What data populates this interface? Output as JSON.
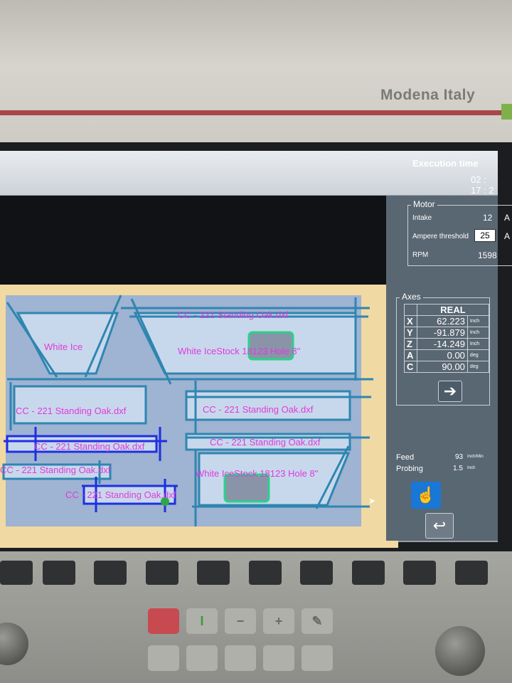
{
  "brand": "Modena Italy",
  "execution": {
    "label": "Execution time",
    "value": "02 : 17 : 2"
  },
  "motor": {
    "title": "Motor",
    "intake_label": "Intake",
    "intake_value": "12",
    "intake_unit": "A",
    "threshold_label": "Ampere threshold",
    "threshold_value": "25",
    "threshold_unit": "A",
    "rpm_label": "RPM",
    "rpm_value": "1598"
  },
  "axes": {
    "title": "Axes",
    "header": "REAL",
    "rows": [
      {
        "name": "X",
        "value": "62.223",
        "unit": "Inch"
      },
      {
        "name": "Y",
        "value": "-91.879",
        "unit": "Inch"
      },
      {
        "name": "Z",
        "value": "-14.249",
        "unit": "Inch"
      },
      {
        "name": "A",
        "value": "0.00",
        "unit": "deg"
      },
      {
        "name": "C",
        "value": "90.00",
        "unit": "deg"
      }
    ]
  },
  "feed": {
    "label": "Feed",
    "value": "93",
    "unit": "Inch/Min"
  },
  "probing": {
    "label": "Probing",
    "value": "1.5",
    "unit": "Inch"
  },
  "parts": [
    {
      "name": "part-white-ice",
      "label": "White Ice"
    },
    {
      "name": "part-top-right",
      "label": "CC - 221 Standing Oak.dxf"
    },
    {
      "name": "part-top-right-body",
      "label": "White IceStock 18123 Hole 8\""
    },
    {
      "name": "part-left-1",
      "label": "CC - 221 Standing Oak.dxf"
    },
    {
      "name": "part-right-1",
      "label": "CC - 221 Standing Oak.dxf"
    },
    {
      "name": "part-left-2",
      "label": "CC - 221 Standing Oak.dxf"
    },
    {
      "name": "part-right-2",
      "label": "CC - 221 Standing Oak.dxf"
    },
    {
      "name": "part-left-3",
      "label": "CC - 221 Standing Oak.dxf"
    },
    {
      "name": "part-right-3-body",
      "label": "White IceStock 18123 Hole 8\""
    },
    {
      "name": "part-bottom",
      "label": "CC - 221 Standing Oak.dxf"
    }
  ],
  "icons": {
    "go": "arrow-right-circle-icon",
    "probe": "hand-pointer-icon",
    "back": "return-arrow-icon"
  },
  "colors": {
    "sheet": "#f1d9a3",
    "part_fill": "#c8d8ec",
    "cut_line": "#2f86b0",
    "label": "#e03adc",
    "selection": "#1f2fe0",
    "hole": "#2ad38a"
  }
}
